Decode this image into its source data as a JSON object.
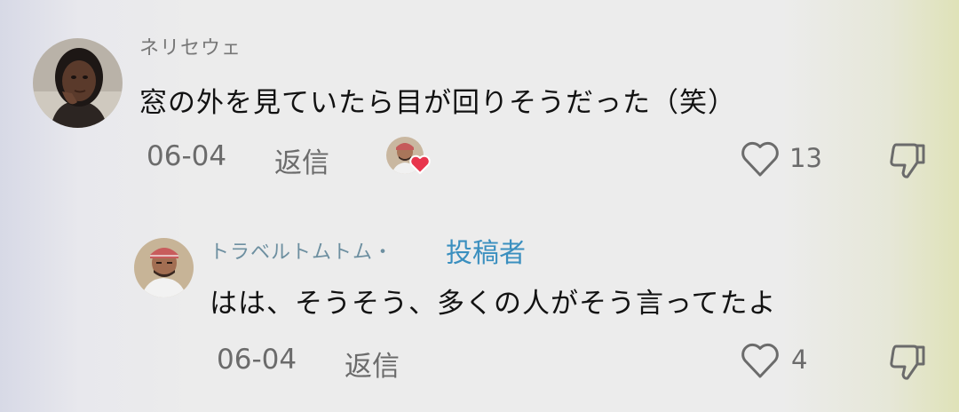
{
  "comment": {
    "username": "ネリセウェ",
    "text": "窓の外を見ていたら目が回りそうだった（笑）",
    "date": "06-04",
    "reply_label": "返信",
    "like_count": "13",
    "avatar_icon": "user-avatar",
    "liked_by_author_icon": "author-heart-badge"
  },
  "reply": {
    "username": "トラベルトムトム・",
    "author_badge": "投稿者",
    "text": "はは、そうそう、多くの人がそう言ってたよ",
    "date": "06-04",
    "reply_label": "返信",
    "like_count": "4",
    "avatar_icon": "user-avatar"
  },
  "colors": {
    "author_badge": "#3a8fbf",
    "heart_badge": "#e8354d",
    "text": "#121212",
    "meta": "#6b6b6b"
  }
}
